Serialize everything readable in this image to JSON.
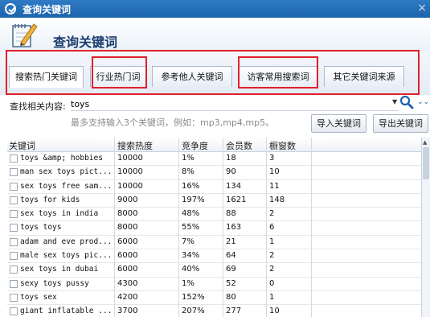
{
  "window": {
    "title": "查询关键词",
    "close": "×"
  },
  "header": {
    "title": "查询关键词"
  },
  "tabs": [
    {
      "label": "搜索热门关键词",
      "active": true
    },
    {
      "label": "行业热门词",
      "active": false
    },
    {
      "label": "参考他人关键词",
      "active": false
    },
    {
      "label": "访客常用搜索词",
      "active": false
    },
    {
      "label": "其它关键词来源",
      "active": false
    }
  ],
  "search": {
    "label": "查找相关内容:",
    "value": "toys",
    "hint": "最多支持输入3个关键词，例如：mp3,mp4,mp5。",
    "import_label": "导入关键词",
    "export_label": "导出关键词"
  },
  "table": {
    "columns": [
      "关键词",
      "搜索热度",
      "竞争度",
      "会员数",
      "橱窗数"
    ],
    "rows": [
      [
        "toys &amp; hobbies",
        "10000",
        "1%",
        "18",
        "3"
      ],
      [
        "man sex toys pict...",
        "10000",
        "8%",
        "90",
        "10"
      ],
      [
        "sex toys free sam...",
        "10000",
        "16%",
        "134",
        "11"
      ],
      [
        "toys for kids",
        "9000",
        "197%",
        "1621",
        "148"
      ],
      [
        "sex toys in india",
        "8000",
        "48%",
        "88",
        "2"
      ],
      [
        "toys toys",
        "8000",
        "55%",
        "163",
        "6"
      ],
      [
        "adam and eve prod...",
        "6000",
        "7%",
        "21",
        "1"
      ],
      [
        "male sex toys pic...",
        "6000",
        "34%",
        "64",
        "2"
      ],
      [
        "sex toys in dubai",
        "6000",
        "40%",
        "69",
        "2"
      ],
      [
        "sexy toys pussy",
        "4300",
        "1%",
        "52",
        "0"
      ],
      [
        "toys sex",
        "4200",
        "152%",
        "80",
        "1"
      ],
      [
        "giant inflatable ...",
        "3700",
        "207%",
        "277",
        "10"
      ]
    ]
  },
  "colors": {
    "title_bar": "#1b63ad",
    "highlight": "#e0202a",
    "header_text": "#1a3d6d"
  },
  "icons": [
    "check-circle-icon",
    "notepad-pen-icon",
    "search-icon",
    "dropdown-arrow-icon",
    "double-chevron-down-icon"
  ]
}
